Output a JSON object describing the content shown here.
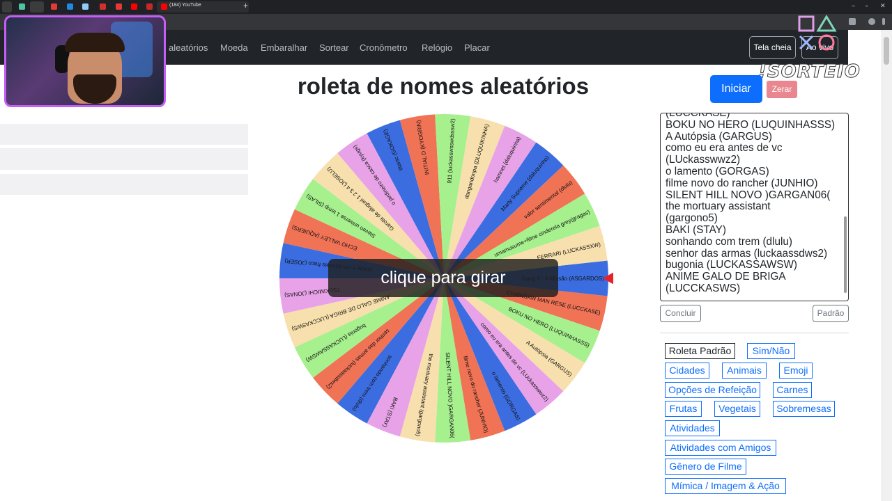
{
  "browser": {
    "tab_title": "(184) YouTube",
    "window_controls": [
      "–",
      "▫",
      "✕"
    ]
  },
  "navbar": {
    "links": [
      "aleatórios",
      "Moeda",
      "Embaralhar",
      "Sortear",
      "Cronômetro",
      "Relógio",
      "Placar"
    ],
    "fullscreen_label": "Tela cheia",
    "live_label": "Ao vivo"
  },
  "overlay": {
    "logo_text": "!SORTEIO"
  },
  "page": {
    "title": "roleta de nomes aleatórios",
    "start_label": "Iniciar",
    "reset_label": "Zerar",
    "spin_prompt": "clique para girar"
  },
  "wheel": {
    "pointer_color": "#e8202a",
    "colors": [
      "#3b6de0",
      "#f07356",
      "#a6f08e",
      "#f7e0ad",
      "#e8a3e8"
    ],
    "segments": [
      "Gang 2 - A Missão (ASGARDOS)",
      "CHAINSAW MAN RESE (LUCCKASE)",
      "BOKU NO HERO (LUQUINHASSS)",
      "A Autópsia (GARGUS)",
      "como eu era antes de vc (LUckasswwz2)",
      "o lamento (GORGAS)",
      "filme novo do rancher (JUNHIO)",
      "SILENT HILL NOVO )GARGAN06(",
      "the mortuary assistant (gargono5)",
      "BAKI (STAY)",
      "sonhando com trem (dlulu)",
      "senhor das armas (luckaassdws2)",
      "bugonia (LUCKASSAWSW)",
      "ANIME GALO DE BRIGA (LUCCKASWS)",
      "TSUKIMICHI (JONAS)",
      "pocoe e um do mais fraco (JOSER)",
      "ECHO VALLEY (AQUIERS)",
      "Steven universe 1 temp (SILAS)",
      "Garota de aluguel 1 2 3 4 (JOSELU)",
      "o jardineiro de casca (kyugs)",
      "titanic (GOKAGE)",
      "INITIAL D (KYOGRIN)",
      "911 (luckasswsswdsssw2)",
      "dangandonpa (DLUQUIKINHA)",
      "hamnet (daluquinha)",
      "Marty Supreme (daluquinho)",
      "valor sentimental (dlulu)",
      "umamusume+filme cinderela grey(gragas)",
      "FERRARI (LUCKASSXW)"
    ]
  },
  "names_list": {
    "text": "(LUCCKASE)\nBOKU NO HERO (LUQUINHASSS)\nA Autópsia (GARGUS)\ncomo eu era antes de vc\n(LUckasswwz2)\no lamento (GORGAS)\nfilme novo do rancher (JUNHIO)\nSILENT HILL NOVO )GARGAN06(\nthe mortuary assistant\n(gargono5)\nBAKI (STAY)\nsonhando com trem (dlulu)\nsenhor das armas (luckaassdws2)\nbugonia (LUCKASSAWSW)\nANIME GALO DE BRIGA\n(LUCCKASWS)",
    "conclude_label": "Concluir",
    "default_label": "Padrão"
  },
  "presets": [
    "Roleta Padrão",
    "Sim/Não",
    "Cidades",
    "Animais",
    "Emoji",
    "Opções de Refeição",
    "Carnes",
    "Frutas",
    "Vegetais",
    "Sobremesas",
    "Atividades",
    "Atividades com Amigos",
    "Gênero de Filme",
    "Mímica / Imagem & Ação"
  ]
}
